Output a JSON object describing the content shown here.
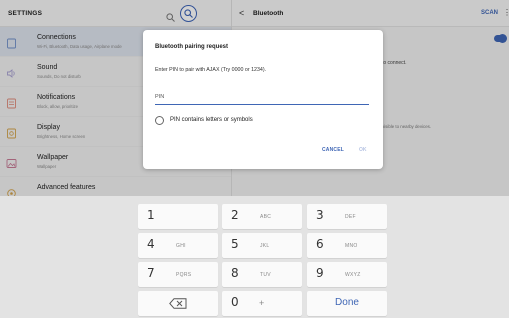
{
  "settings_panel": {
    "title": "SETTINGS",
    "items": [
      {
        "title": "Connections",
        "subtitle": "Wi-Fi, Bluetooth, Data usage, Airplane mode",
        "icon": "connections-icon",
        "active": true
      },
      {
        "title": "Sound",
        "subtitle": "Sounds, Do not disturb",
        "icon": "sound-icon",
        "active": false
      },
      {
        "title": "Notifications",
        "subtitle": "Block, allow, prioritize",
        "icon": "notifications-icon",
        "active": false
      },
      {
        "title": "Display",
        "subtitle": "Brightness, Home screen",
        "icon": "display-icon",
        "active": false
      },
      {
        "title": "Wallpaper",
        "subtitle": "Wallpaper",
        "icon": "wallpaper-icon",
        "active": false
      },
      {
        "title": "Advanced features",
        "subtitle": "",
        "icon": "advanced-features-icon",
        "active": false
      }
    ]
  },
  "bluetooth_panel": {
    "title": "Bluetooth",
    "scan_label": "SCAN",
    "more_label": "⋮",
    "back_label": "<",
    "text_connect": "to connect.",
    "text_visible": "visible to nearby devices."
  },
  "dialog": {
    "title": "Bluetooth pairing request",
    "message": "Enter PIN to pair with AJAX (Try 0000 or 1234).",
    "pin_placeholder": "PIN",
    "pin_value": "",
    "checkbox_label": "PIN contains letters or symbols",
    "checkbox_checked": false,
    "cancel_label": "CANCEL",
    "ok_label": "OK"
  },
  "keyboard": {
    "keys": [
      {
        "digit": "1",
        "letters": ""
      },
      {
        "digit": "2",
        "letters": "ABC"
      },
      {
        "digit": "3",
        "letters": "DEF"
      },
      {
        "digit": "4",
        "letters": "GHI"
      },
      {
        "digit": "5",
        "letters": "JKL"
      },
      {
        "digit": "6",
        "letters": "MNO"
      },
      {
        "digit": "7",
        "letters": "PQRS"
      },
      {
        "digit": "8",
        "letters": "TUV"
      },
      {
        "digit": "9",
        "letters": "WXYZ"
      },
      {
        "digit": "0",
        "letters": "+"
      }
    ],
    "done_label": "Done"
  },
  "colors": {
    "accent": "#3f66b5",
    "ok_disabled": "#b6c3e3"
  }
}
